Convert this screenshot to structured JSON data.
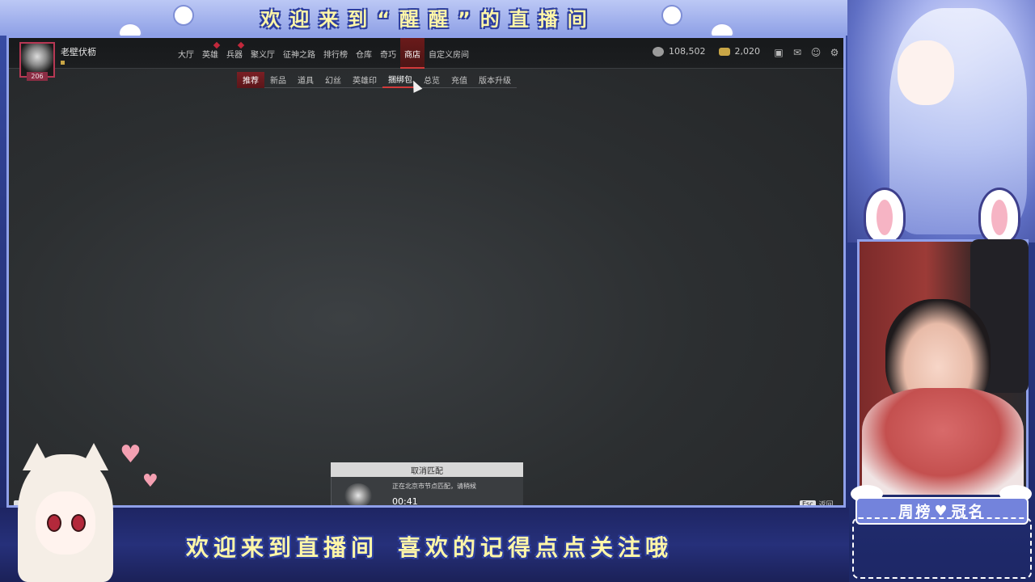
{
  "overlay": {
    "top_banner": "欢迎来到“醒醒”的直播间",
    "bottom_banner_part1": "欢迎来到直播间",
    "bottom_banner_part2": "喜欢的记得点点关注哦",
    "name_tag_left": "周榜",
    "name_tag_right": "冠名",
    "accent_color": "#8fa0ea",
    "banner_text_color": "#fff6a8"
  },
  "game": {
    "player": {
      "name": "老壁伏枥",
      "level": "206"
    },
    "nav": {
      "items": [
        {
          "label": "大厅",
          "active": false,
          "dot": false
        },
        {
          "label": "英雄",
          "active": false,
          "dot": true
        },
        {
          "label": "兵器",
          "active": false,
          "dot": true
        },
        {
          "label": "聚义厅",
          "active": false,
          "dot": false
        },
        {
          "label": "征神之路",
          "active": false,
          "dot": false
        },
        {
          "label": "排行榜",
          "active": false,
          "dot": false
        },
        {
          "label": "仓库",
          "active": false,
          "dot": false
        },
        {
          "label": "奇巧",
          "active": false,
          "dot": false
        },
        {
          "label": "商店",
          "active": true,
          "dot": false
        },
        {
          "label": "自定义房间",
          "active": false,
          "dot": false
        }
      ]
    },
    "currency": {
      "coins": "108,502",
      "gold": "2,020"
    },
    "top_icons": [
      "help-icon",
      "mail-icon",
      "friends-icon",
      "settings-icon"
    ],
    "subnav": {
      "items": [
        {
          "label": "推荐",
          "state": "active"
        },
        {
          "label": "新品",
          "state": ""
        },
        {
          "label": "道具",
          "state": ""
        },
        {
          "label": "幻丝",
          "state": ""
        },
        {
          "label": "英雄印",
          "state": ""
        },
        {
          "label": "捆绑包",
          "state": "hover"
        },
        {
          "label": "总览",
          "state": ""
        },
        {
          "label": "充值",
          "state": ""
        },
        {
          "label": "版本升级",
          "state": ""
        }
      ]
    },
    "match": {
      "cancel_label": "取消匹配",
      "status": "正在北京市节点匹配，请稍候",
      "timer": "00:41"
    },
    "esc_key": "Esc",
    "esc_label": "返回",
    "left_hint_text": "天"
  }
}
